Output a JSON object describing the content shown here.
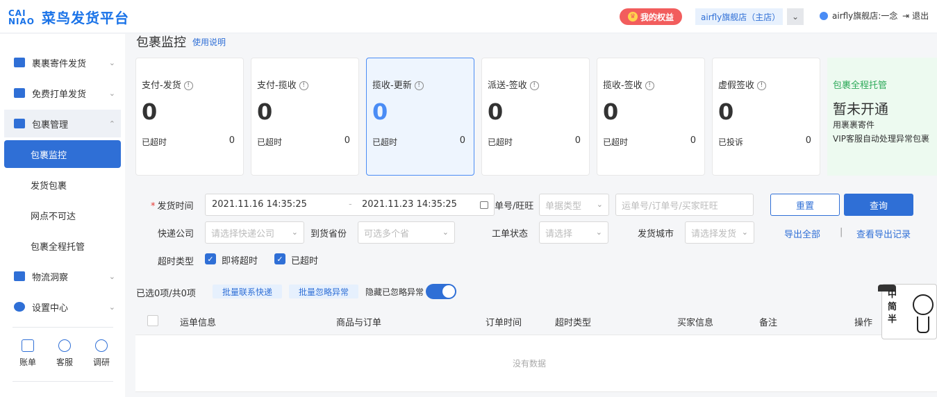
{
  "header": {
    "logo_mark_top": "CAI",
    "logo_mark_bottom": "NIAO",
    "logo_title": "菜鸟发货平台",
    "rights_label": "我的权益",
    "shop_name": "airfly旗舰店（主店）",
    "user_name": "airfly旗舰店:一念",
    "logout_label": "退出"
  },
  "sidebar": {
    "items": [
      {
        "label": "裹裹寄件发货",
        "icon": "parcel-icon"
      },
      {
        "label": "免费打单发货",
        "icon": "printer-icon"
      },
      {
        "label": "包裹管理",
        "icon": "package-icon"
      },
      {
        "label": "包裹监控"
      },
      {
        "label": "发货包裹"
      },
      {
        "label": "网点不可达"
      },
      {
        "label": "包裹全程托管"
      },
      {
        "label": "物流洞察",
        "icon": "bar-chart-icon"
      },
      {
        "label": "设置中心",
        "icon": "settings-icon"
      }
    ],
    "tools": [
      {
        "label": "账单",
        "icon": "bill-icon"
      },
      {
        "label": "客服",
        "icon": "service-icon"
      },
      {
        "label": "调研",
        "icon": "survey-icon"
      }
    ]
  },
  "page": {
    "title": "包裹监控",
    "help_link": "使用说明"
  },
  "cards": [
    {
      "label": "支付-发货",
      "value": "0",
      "sub_label": "已超时",
      "sub_value": "0"
    },
    {
      "label": "支付-揽收",
      "value": "0",
      "sub_label": "已超时",
      "sub_value": "0"
    },
    {
      "label": "揽收-更新",
      "value": "0",
      "sub_label": "已超时",
      "sub_value": "0"
    },
    {
      "label": "派送-签收",
      "value": "0",
      "sub_label": "已超时",
      "sub_value": "0"
    },
    {
      "label": "揽收-签收",
      "value": "0",
      "sub_label": "已超时",
      "sub_value": "0"
    },
    {
      "label": "虚假签收",
      "value": "0",
      "sub_label": "已投诉",
      "sub_value": "0"
    }
  ],
  "promo": {
    "title": "包裹全程托管",
    "status": "暂未开通",
    "line1": "用裹裹寄件",
    "line2": "VIP客服自动处理异常包裹"
  },
  "filters": {
    "ship_time_label": "发货时间",
    "date_start": "2021.11.16 14:35:25",
    "date_separator": "-",
    "date_end": "2021.11.23 14:35:25",
    "order_no_label_partial": "单号/旺旺",
    "doc_type_placeholder": "单据类型",
    "search_placeholder": "运单号/订单号/买家旺旺",
    "courier_label": "快递公司",
    "courier_placeholder": "请选择快递公司",
    "province_label": "到货省份",
    "province_placeholder": "可选多个省",
    "ticket_status_label": "工单状态",
    "ticket_status_placeholder": "请选择",
    "ship_city_label": "发货城市",
    "ship_city_placeholder": "请选择发货",
    "timeout_type_label": "超时类型",
    "opt_near_timeout": "即将超时",
    "opt_timed_out": "已超时",
    "reset_button": "重置",
    "query_button": "查询",
    "export_all": "导出全部",
    "divider": "|",
    "export_records": "查看导出记录"
  },
  "toolbar": {
    "selected_text": "已选0项/共0项",
    "batch_contact": "批量联系快递",
    "batch_ignore": "批量忽略异常",
    "hide_ignored": "隐藏已忽略异常",
    "hide_ignored_on": true
  },
  "table": {
    "columns": [
      "运单信息",
      "商品与订单",
      "订单时间",
      "超时类型",
      "买家信息",
      "备注",
      "操作"
    ],
    "empty_text": "没有数据"
  },
  "widget": {
    "text": "中简半"
  },
  "colors": {
    "primary": "#2f6fd6",
    "danger": "#f25d5d",
    "success": "#2eaa5a"
  }
}
